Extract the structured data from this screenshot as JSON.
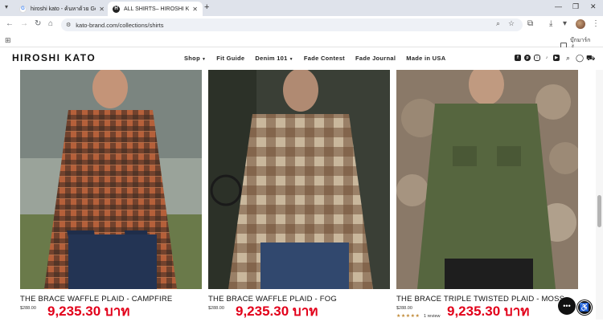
{
  "browser": {
    "tabs": [
      {
        "title": "hiroshi kato - ค้นหาด้วย Google",
        "icon": "google-icon"
      },
      {
        "title": "ALL SHIRTS– HIROSHI KATO | C",
        "icon": "hiroshi-kato-favicon"
      }
    ],
    "url": "kato-brand.com/collections/shirts",
    "bookmark_folder": "บุ๊กมาร์กทั้งหมด"
  },
  "site": {
    "logo": "HIROSHI KATO",
    "nav": [
      {
        "label": "Shop",
        "has_dropdown": true
      },
      {
        "label": "Fit Guide"
      },
      {
        "label": "Denim 101",
        "has_dropdown": true
      },
      {
        "label": "Fade Contest"
      },
      {
        "label": "Fade Journal"
      },
      {
        "label": "Made in USA"
      }
    ],
    "social": [
      "facebook-icon",
      "pinterest-icon",
      "instagram-icon",
      "tiktok-icon",
      "youtube-icon"
    ]
  },
  "products": [
    {
      "name": "THE BRACE WAFFLE PLAID - CAMPFIRE",
      "price": "$288.00",
      "price_thb": "9,235.30 บาท",
      "colors": {
        "a": "#b5603a",
        "b": "#3b2a22"
      }
    },
    {
      "name": "THE BRACE WAFFLE PLAID - FOG",
      "price": "$288.00",
      "price_thb": "9,235.30 บาท",
      "colors": {
        "a": "#c9b79c",
        "b": "#6b4a32"
      }
    },
    {
      "name": "THE BRACE TRIPLE TWISTED PLAID - MOSS",
      "price": "$288.00",
      "price_thb": "9,235.30 บาท",
      "stars": "★★★★★",
      "review": "1 review",
      "colors": {
        "a": "#56663f",
        "b": "#3f4c2e"
      }
    }
  ]
}
